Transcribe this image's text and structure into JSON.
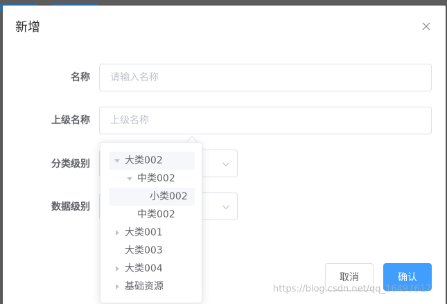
{
  "dialog": {
    "title": "新增"
  },
  "form": {
    "name_label": "名称",
    "name_placeholder": "请输入名称",
    "parent_label": "上级名称",
    "parent_placeholder": "上级名称",
    "category_label": "分类级别",
    "data_label": "数据级别"
  },
  "tree": {
    "nodes": [
      {
        "label": "大类002",
        "expanded": true
      },
      {
        "label": "中类002",
        "expanded": true
      },
      {
        "label": "小类002",
        "expanded": false
      },
      {
        "label": "中类002",
        "expanded": false
      },
      {
        "label": "大类001",
        "expanded": false
      },
      {
        "label": "大类003",
        "expanded": false
      },
      {
        "label": "大类004",
        "expanded": false
      },
      {
        "label": "基础资源",
        "expanded": false
      }
    ]
  },
  "buttons": {
    "cancel": "取消",
    "confirm": "确认"
  },
  "watermark": "https://blog.csdn.net/qq_16497617",
  "colors": {
    "primary": "#409eff",
    "border": "#dcdfe6",
    "placeholder": "#c0c4cc",
    "hover_bg": "#f5f7fa"
  },
  "icons": {
    "close": "close-icon",
    "select_arrow": "chevron-down-icon",
    "tree_caret": "caret-right-icon"
  }
}
